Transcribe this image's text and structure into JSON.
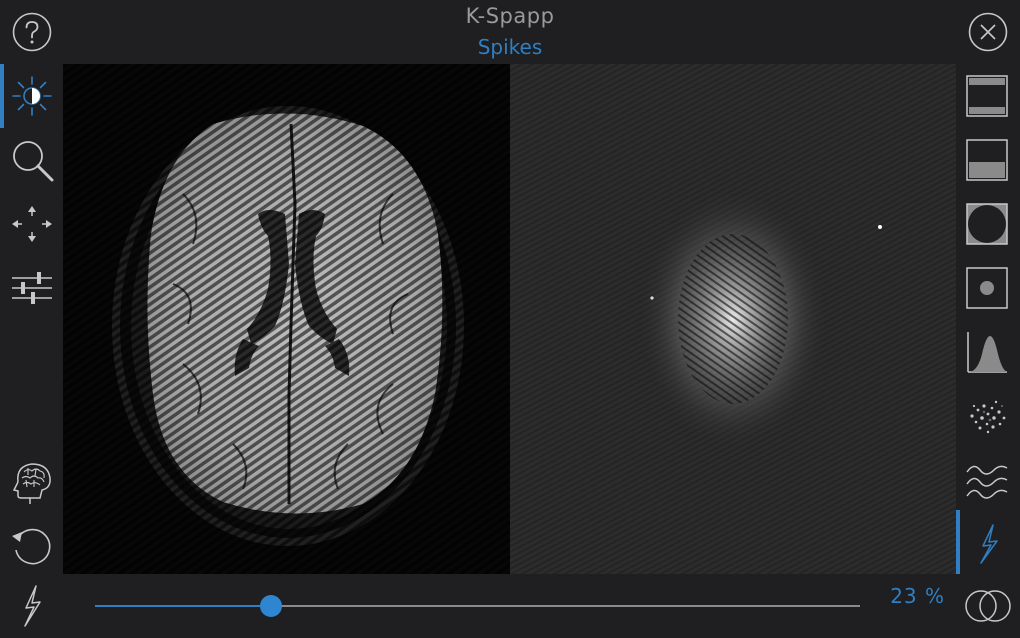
{
  "header": {
    "title": "K-Spapp",
    "subtitle": "Spikes"
  },
  "left_toolbar": {
    "tools": [
      {
        "icon": "brightness-contrast-icon",
        "active": true
      },
      {
        "icon": "magnifier-icon"
      },
      {
        "icon": "pan-arrows-icon"
      },
      {
        "icon": "sliders-icon"
      },
      {
        "icon": "brain-head-icon"
      },
      {
        "icon": "reset-icon"
      }
    ]
  },
  "right_toolbar": {
    "tools": [
      {
        "icon": "high-pass-filter-icon"
      },
      {
        "icon": "low-pass-filter-icon"
      },
      {
        "icon": "circle-mask-icon"
      },
      {
        "icon": "dot-mask-icon"
      },
      {
        "icon": "distribution-curve-icon"
      },
      {
        "icon": "noise-icon"
      },
      {
        "icon": "waves-icon"
      },
      {
        "icon": "spikes-bolt-icon",
        "active": true
      }
    ]
  },
  "bottom": {
    "slider_value": 0.23,
    "percent_label": "23 %"
  },
  "colors": {
    "accent": "#2f7fc2",
    "background": "#1f1f21",
    "icon": "#c8c8c8"
  }
}
